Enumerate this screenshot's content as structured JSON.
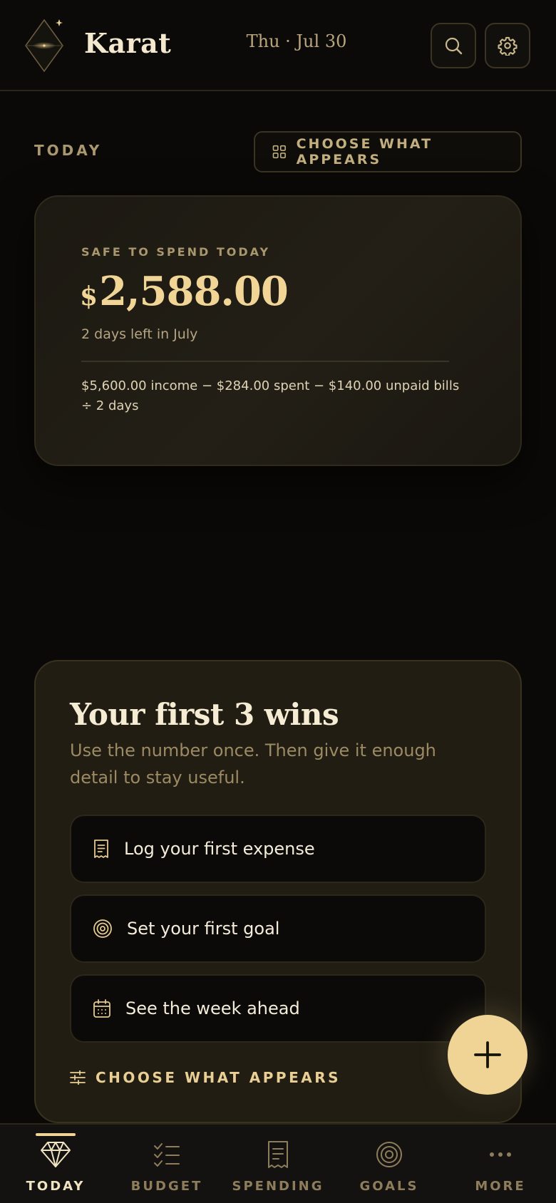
{
  "header": {
    "brand": "Karat",
    "date": "Thu · Jul 30"
  },
  "section": {
    "label": "TODAY",
    "choose_label": "CHOOSE WHAT APPEARS"
  },
  "safe_to_spend": {
    "title": "SAFE TO SPEND TODAY",
    "currency": "$",
    "amount": "2,588.00",
    "subtitle": "2 days left in July",
    "formula": "$5,600.00 income − $284.00 spent − $140.00 unpaid bills ÷ 2 days"
  },
  "wins": {
    "title": "Your first 3 wins",
    "subtitle": "Use the number once. Then give it enough detail to stay useful.",
    "items": [
      {
        "label": "Log your first expense",
        "icon": "receipt-icon"
      },
      {
        "label": "Set your first goal",
        "icon": "target-icon"
      },
      {
        "label": "See the week ahead",
        "icon": "calendar-icon"
      }
    ],
    "choose_label": "CHOOSE WHAT APPEARS"
  },
  "nav": {
    "items": [
      {
        "label": "TODAY",
        "icon": "diamond-icon",
        "active": true
      },
      {
        "label": "BUDGET",
        "icon": "checklist-icon",
        "active": false
      },
      {
        "label": "SPENDING",
        "icon": "receipt-icon",
        "active": false
      },
      {
        "label": "GOALS",
        "icon": "target-icon",
        "active": false
      },
      {
        "label": "MORE",
        "icon": "more-icon",
        "active": false
      }
    ]
  },
  "colors": {
    "background": "#0a0907",
    "accent_gold": "#efd496",
    "muted_gold": "#a9976e",
    "card": "#211d13"
  }
}
